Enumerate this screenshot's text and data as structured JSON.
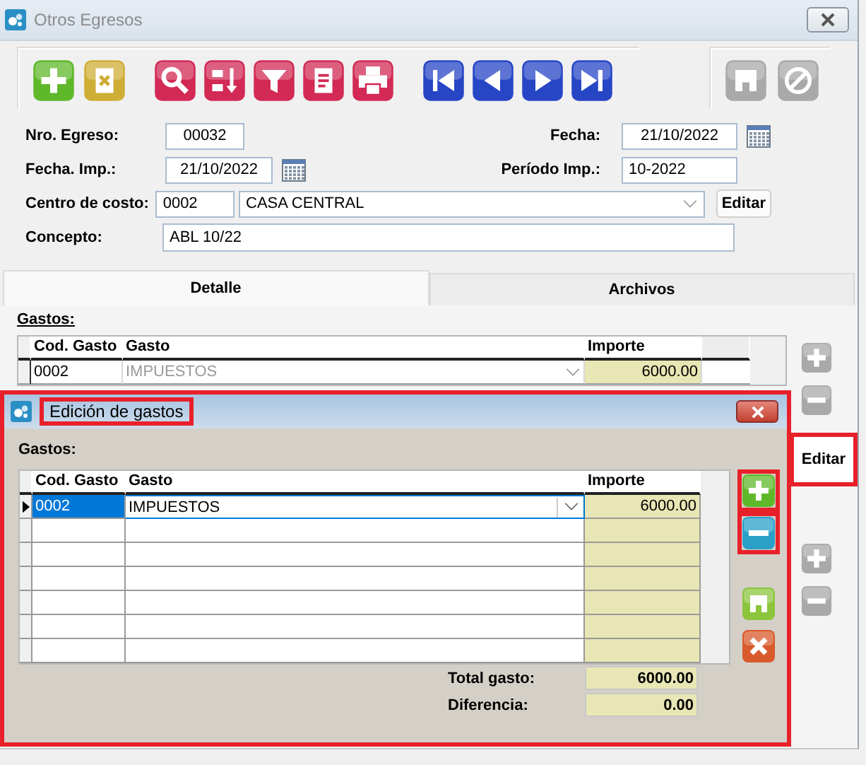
{
  "window": {
    "title": "Otros Egresos"
  },
  "toolbar": {
    "left": [
      {
        "kind": "add",
        "disabled": false
      },
      {
        "kind": "delete",
        "disabled": false
      },
      {
        "kind": "search",
        "disabled": false
      },
      {
        "kind": "sort",
        "disabled": false
      },
      {
        "kind": "filter",
        "disabled": false
      },
      {
        "kind": "report",
        "disabled": false
      },
      {
        "kind": "print",
        "disabled": false
      },
      {
        "kind": "first",
        "disabled": false
      },
      {
        "kind": "prev",
        "disabled": false
      },
      {
        "kind": "next",
        "disabled": false
      },
      {
        "kind": "last",
        "disabled": false
      }
    ],
    "right": [
      {
        "kind": "save",
        "disabled": true
      },
      {
        "kind": "cancel",
        "disabled": true
      }
    ]
  },
  "form": {
    "nro_egreso": {
      "label": "Nro. Egreso:",
      "value": "00032"
    },
    "fecha": {
      "label": "Fecha:",
      "value": "21/10/2022"
    },
    "fecha_imp": {
      "label": "Fecha. Imp.:",
      "value": "21/10/2022"
    },
    "periodo_imp": {
      "label": "Período Imp.:",
      "value": "10-2022"
    },
    "centro_costo": {
      "label": "Centro de costo:",
      "code": "0002",
      "name": "CASA CENTRAL",
      "button": "Editar"
    },
    "concepto": {
      "label": "Concepto:",
      "value": "ABL 10/22"
    }
  },
  "tabs": [
    {
      "label": "Detalle",
      "selected": true
    },
    {
      "label": "Archivos",
      "selected": false
    }
  ],
  "detail": {
    "section_label": "Gastos:",
    "columns": [
      "Cod. Gasto",
      "Gasto",
      "Importe"
    ],
    "rows": [
      {
        "code": "0002",
        "gasto": "IMPUESTOS",
        "importe": "6000.00"
      }
    ],
    "side_buttons": [
      {
        "kind": "add",
        "disabled": true
      },
      {
        "kind": "remove",
        "disabled": true
      }
    ],
    "edit_button": {
      "label": "Editar",
      "highlighted": true
    },
    "lower_buttons": [
      {
        "kind": "add",
        "disabled": true
      },
      {
        "kind": "remove",
        "disabled": true
      }
    ]
  },
  "dialog": {
    "title": "Edición de gastos",
    "highlighted": true,
    "title_highlighted": true,
    "section_label": "Gastos:",
    "columns": [
      "Cod. Gasto",
      "Gasto",
      "Importe"
    ],
    "rows": [
      {
        "code": "0002",
        "gasto": "IMPUESTOS",
        "importe": "6000.00",
        "selected": true
      }
    ],
    "buttons": [
      {
        "kind": "add",
        "highlighted": true
      },
      {
        "kind": "remove",
        "highlighted": true
      },
      {
        "kind": "save"
      },
      {
        "kind": "cross"
      }
    ],
    "totals": [
      {
        "label": "Total gasto:",
        "value": "6000.00"
      },
      {
        "label": "Diferencia:",
        "value": "0.00"
      }
    ]
  }
}
